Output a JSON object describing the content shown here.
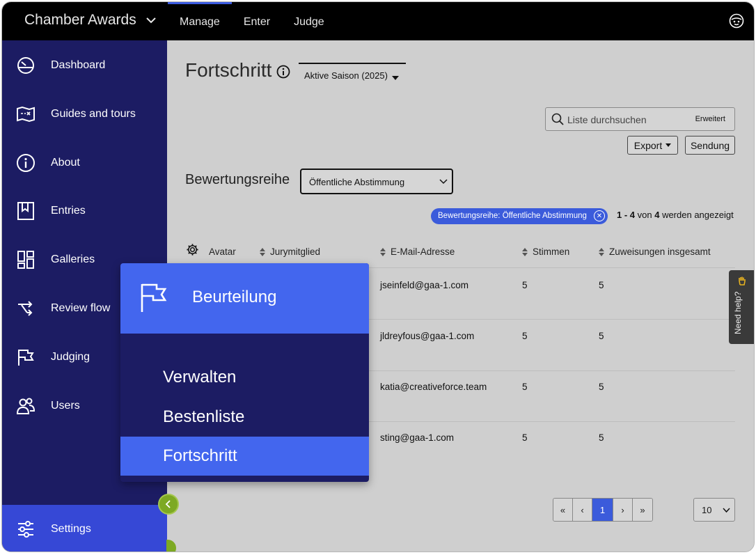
{
  "app": {
    "title": "Chamber Awards"
  },
  "topnav": {
    "items": [
      "Manage",
      "Enter",
      "Judge"
    ],
    "active": "Manage"
  },
  "sidebar": {
    "items": [
      {
        "label": "Dashboard",
        "icon": "dashboard-icon"
      },
      {
        "label": "Guides and tours",
        "icon": "map-icon"
      },
      {
        "label": "About",
        "icon": "info-icon"
      },
      {
        "label": "Entries",
        "icon": "bookmark-icon"
      },
      {
        "label": "Galleries",
        "icon": "galleries-icon"
      },
      {
        "label": "Review flow",
        "icon": "review-flow-icon"
      },
      {
        "label": "Judging",
        "icon": "flag-icon"
      },
      {
        "label": "Users",
        "icon": "users-icon"
      }
    ],
    "settings": {
      "label": "Settings",
      "icon": "sliders-icon"
    }
  },
  "page": {
    "title": "Fortschritt",
    "season": "Aktive Saison (2025)",
    "search": {
      "placeholder": "Liste durchsuchen",
      "advanced": "Erweitert"
    },
    "buttons": {
      "export": "Export",
      "send": "Sendung"
    },
    "round_label": "Bewertungsreihe",
    "round_value": "Öffentliche Abstimmung",
    "filter_chip": "Bewertungsreihe: Öffentliche Abstimmung",
    "count": {
      "from": "1",
      "to": "4",
      "total": "4",
      "sep": " - ",
      "von": " von ",
      "suffix": " werden angezeigt"
    }
  },
  "table": {
    "headers": {
      "avatar": "Avatar",
      "judge": "Jurymitglied",
      "email": "E-Mail-Adresse",
      "votes": "Stimmen",
      "assignments": "Zuweisungen insgesamt"
    },
    "rows": [
      {
        "email": "jseinfeld@gaa-1.com",
        "votes": "5",
        "assignments": "5"
      },
      {
        "email": "jldreyfous@gaa-1.com",
        "votes": "5",
        "assignments": "5"
      },
      {
        "email": "katia@creativeforce.team",
        "votes": "5",
        "assignments": "5"
      },
      {
        "email": "sting@gaa-1.com",
        "votes": "5",
        "assignments": "5"
      }
    ]
  },
  "pagination": {
    "first": "«",
    "prev": "‹",
    "current": "1",
    "next": "›",
    "last": "»",
    "per_page": "10"
  },
  "help": {
    "label": "Need help?"
  },
  "popup": {
    "title": "Beurteilung",
    "items": [
      "Verwalten",
      "Bestenliste",
      "Fortschritt"
    ],
    "active": "Fortschritt"
  },
  "colors": {
    "sidebar": "#1c1c63",
    "accent": "#4366ee",
    "chip": "#3b5bdb",
    "collapse": "#7da923"
  }
}
